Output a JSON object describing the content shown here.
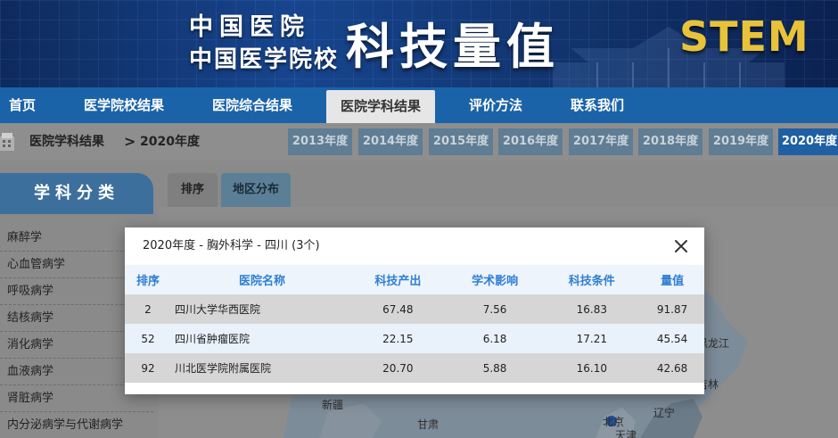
{
  "banner": {
    "logo_line1": "中国医院",
    "logo_line2": "中国医学院校",
    "main_title": "科技量值",
    "stem_text": "STEM"
  },
  "nav": {
    "items": [
      {
        "label": "首页"
      },
      {
        "label": "医学院校结果"
      },
      {
        "label": "医院综合结果"
      },
      {
        "label": "医院学科结果",
        "active": true
      },
      {
        "label": "评价方法"
      },
      {
        "label": "联系我们"
      }
    ]
  },
  "breadcrumb": {
    "section": "医院学科结果",
    "separator": ">",
    "current": "2020年度"
  },
  "years": [
    "2013年度",
    "2014年度",
    "2015年度",
    "2016年度",
    "2017年度",
    "2018年度",
    "2019年度",
    "2020年度"
  ],
  "sidebar": {
    "title": "学科分类",
    "items": [
      "麻醉学",
      "心血管病学",
      "呼吸病学",
      "结核病学",
      "消化病学",
      "血液病学",
      "肾脏病学",
      "内分泌病学与代谢病学"
    ]
  },
  "tabs": [
    "排序",
    "地区分布"
  ],
  "map": {
    "labels": [
      "新疆",
      "甘肃",
      "黑龙江",
      "吉林",
      "辽宁",
      "北京",
      "天津"
    ]
  },
  "modal": {
    "title": "2020年度 - 胸外科学 - 四川 (3个)",
    "columns": [
      "排序",
      "医院名称",
      "科技产出",
      "学术影响",
      "科技条件",
      "量值"
    ],
    "rows": [
      [
        "2",
        "四川大学华西医院",
        "67.48",
        "7.56",
        "16.83",
        "91.87"
      ],
      [
        "52",
        "四川省肿瘤医院",
        "22.15",
        "6.18",
        "17.21",
        "45.54"
      ],
      [
        "92",
        "川北医学院附属医院",
        "20.70",
        "5.88",
        "16.10",
        "42.68"
      ]
    ]
  },
  "colors": {
    "nav_bg": "#1b63a8",
    "header_link": "#2f7fd2",
    "stem": "#e8c33a",
    "active_year": "#1f5fa3"
  }
}
